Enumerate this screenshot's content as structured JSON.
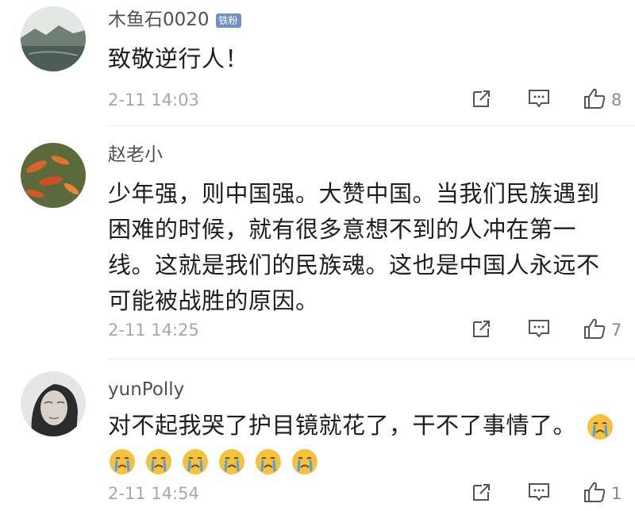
{
  "comments": [
    {
      "username": "木鱼石0020",
      "badge": "铁粉",
      "text": "致敬逆行人！",
      "timestamp": "2-11 14:03",
      "likes": "8"
    },
    {
      "username": "赵老小",
      "badge": "",
      "text": "少年强，则中国强。大赞中国。当我们民族遇到困难的时候，就有很多意想不到的人冲在第一线。这就是我们的民族魂。这也是中国人永远不可能被战胜的原因。",
      "timestamp": "2-11 14:25",
      "likes": "7"
    },
    {
      "username": "yunPolly",
      "badge": "",
      "text": "对不起我哭了护目镜就花了，干不了事情了。",
      "emojis": [
        "crying-face",
        "crying-face",
        "crying-face",
        "crying-face",
        "crying-face",
        "crying-face",
        "crying-face"
      ],
      "timestamp": "2-11 14:54",
      "likes": "1"
    }
  ],
  "icons": {
    "share": "share-icon",
    "reply": "comment-icon",
    "like": "thumbs-up-icon"
  },
  "colors": {
    "badge": "#6f8fc6",
    "timestamp": "#a8a8a8",
    "emoji": "#f6c23e"
  }
}
